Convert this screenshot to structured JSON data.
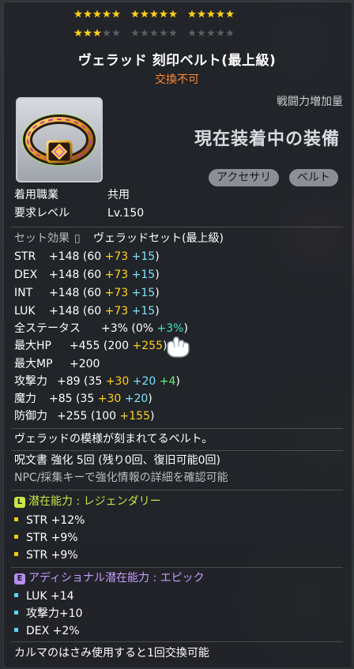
{
  "stars": {
    "groups": [
      [
        "on",
        "on",
        "on",
        "on",
        "on"
      ],
      [
        "on",
        "on",
        "on",
        "on",
        "on"
      ],
      [
        "on",
        "on",
        "on",
        "on",
        "on"
      ],
      [
        "on",
        "on",
        "on",
        "off",
        "off"
      ],
      [
        "off",
        "off",
        "off",
        "off",
        "off"
      ],
      [
        "off",
        "off",
        "off",
        "off",
        "off"
      ]
    ],
    "star_glyph": "★"
  },
  "item": {
    "name": "ヴェラッド 刻印ベルト(最上級)",
    "trade_status": "交換不可",
    "power_label": "戦闘力増加量",
    "equipped_label": "現在装着中の装備",
    "tags": [
      "アクセサリ",
      "ベルト"
    ],
    "icon": "belt-icon"
  },
  "req": [
    {
      "label": "着用職業",
      "value": "共用"
    },
    {
      "label": "要求レベル",
      "value": "Lv.150"
    }
  ],
  "set_effect": {
    "label": "セット効果",
    "value": "ヴェラッドセット(最上級)"
  },
  "stats": [
    {
      "label": "STR",
      "total": "+148",
      "open": "(60 ",
      "yellow": "+73",
      "extra": " +15",
      "close": ")"
    },
    {
      "label": "DEX",
      "total": "+148",
      "open": "(60 ",
      "yellow": "+73",
      "extra": " +15",
      "close": ")"
    },
    {
      "label": "INT",
      "total": "+148",
      "open": "(60 ",
      "yellow": "+73",
      "extra": " +15",
      "close": ")"
    },
    {
      "label": "LUK",
      "total": "+148",
      "open": "(60 ",
      "yellow": "+73",
      "extra": " +15",
      "close": ")"
    }
  ],
  "all_stat": {
    "label": "全ステータス",
    "total": "+3%",
    "open": "(0% ",
    "green": "+3%",
    "close": ")"
  },
  "hp": {
    "label": "最大HP",
    "total": "+455",
    "open": "(200 ",
    "yellow": "+255",
    "close": ")"
  },
  "mp": {
    "label": "最大MP",
    "total": "+200"
  },
  "atk": {
    "label": "攻撃力",
    "total": "+89",
    "open": "(35 ",
    "yellow": "+30",
    "blue": " +20",
    "green": " +4",
    "close": ")"
  },
  "mag": {
    "label": "魔力",
    "total": "+85",
    "open": "(35 ",
    "yellow": "+30",
    "blue": " +20",
    "close": ")"
  },
  "def": {
    "label": "防御力",
    "total": "+255",
    "open": "(100 ",
    "yellow": "+155",
    "close": ")"
  },
  "description": "ヴェラッドの模様が刻まれてるベルト。",
  "scroll": {
    "text": "呪文書 強化 5回 (残り0回、復旧可能0回)"
  },
  "hint": "NPC/採集キーで強化情報の詳細を確認可能",
  "potential": {
    "badge": "L",
    "badge_color": "#c9e545",
    "title": "潜在能力 : レジェンダリー",
    "title_color": "#c9e545",
    "bullet_color": "#f0d000",
    "lines": [
      "STR +12%",
      "STR +9%",
      "STR +9%"
    ]
  },
  "additional": {
    "badge": "E",
    "badge_color": "#b98cf2",
    "title": "アディショナル潜在能力 : エピック",
    "title_color": "#c89cff",
    "bullet_color": "#5fd4f5",
    "lines": [
      "LUK +14",
      "攻撃力+10",
      "DEX +2%"
    ]
  },
  "footer": "カルマのはさみ使用すると1回交換可能",
  "colors": {
    "gold": "#ffd21c",
    "orange": "#ff8a35",
    "green": "#6ef07e",
    "blue": "#7fe0ff"
  }
}
